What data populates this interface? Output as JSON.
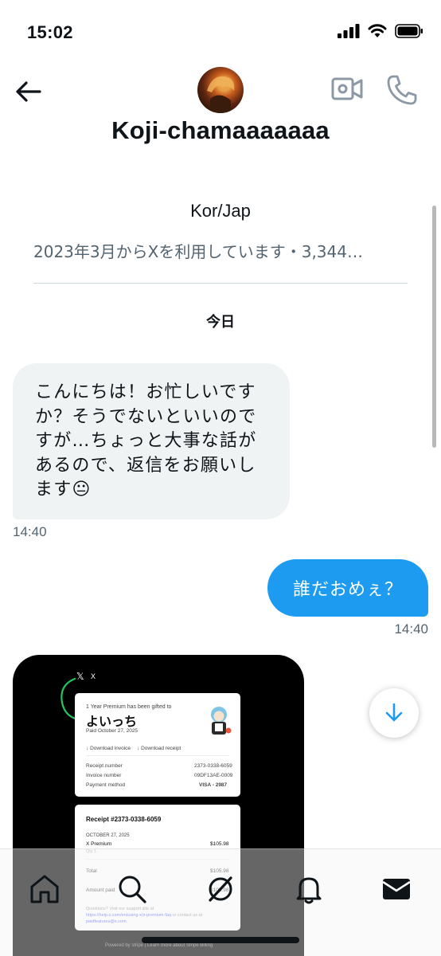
{
  "status_bar": {
    "time": "15:02"
  },
  "header": {
    "display_name": "Koji-chamaaaaaaa",
    "back_icon": "arrow-left-icon",
    "video_icon": "video-camera-icon",
    "call_icon": "phone-icon"
  },
  "profile": {
    "bio": "Kor/Jap",
    "joined": "2023年3月からXを利用しています・3,344…"
  },
  "date_separator": "今日",
  "messages": [
    {
      "direction": "incoming",
      "text": "こんにちは！お忙しいですか？そうでないといいのですが…ちょっと大事な話があるので、返信をお願いします😐",
      "time": "14:40"
    },
    {
      "direction": "outgoing",
      "text": "誰だおめぇ？",
      "time": "14:40"
    }
  ],
  "attachment": {
    "x_logo": "𝕏",
    "x_name": "X",
    "gift_line": "1 Year Premium has been gifted to",
    "recipient": "よいっち",
    "paid_date": "Paid October 27, 2025",
    "download_invoice": "Download invoice",
    "download_receipt": "Download receipt",
    "rows": [
      {
        "label": "Receipt number",
        "value": "2373-0338-6059"
      },
      {
        "label": "Invoice number",
        "value": "09DF13AE-0009"
      },
      {
        "label": "Payment method",
        "value": "VISA - 2987"
      }
    ],
    "receipt_title": "Receipt #2373-0338-6059",
    "receipt_date": "OCTOBER 27, 2025",
    "item_name": "X Premium",
    "item_price": "$105.98",
    "qty": "Qty 1",
    "total_label": "Total",
    "total_value": "$105.98",
    "amount_paid_label": "Amount paid",
    "amount_paid_value": "$105.98",
    "questions": "Questions? Visit our support site at",
    "support_link": "https://help.x.com/en/using-x/x-premium-faq",
    "contact": "or contact us at",
    "email": "paidfeatures@x.com.",
    "powered_by": "Powered by stripe | Learn more about Stripe Billing"
  },
  "bottom_nav": [
    {
      "name": "home",
      "icon": "home-icon"
    },
    {
      "name": "search",
      "icon": "search-icon"
    },
    {
      "name": "grok",
      "icon": "grok-icon"
    },
    {
      "name": "notifications",
      "icon": "bell-icon"
    },
    {
      "name": "messages",
      "icon": "mail-icon"
    }
  ],
  "colors": {
    "accent": "#1d9bf0",
    "muted": "#536471",
    "bubble_in": "#eff3f4"
  }
}
